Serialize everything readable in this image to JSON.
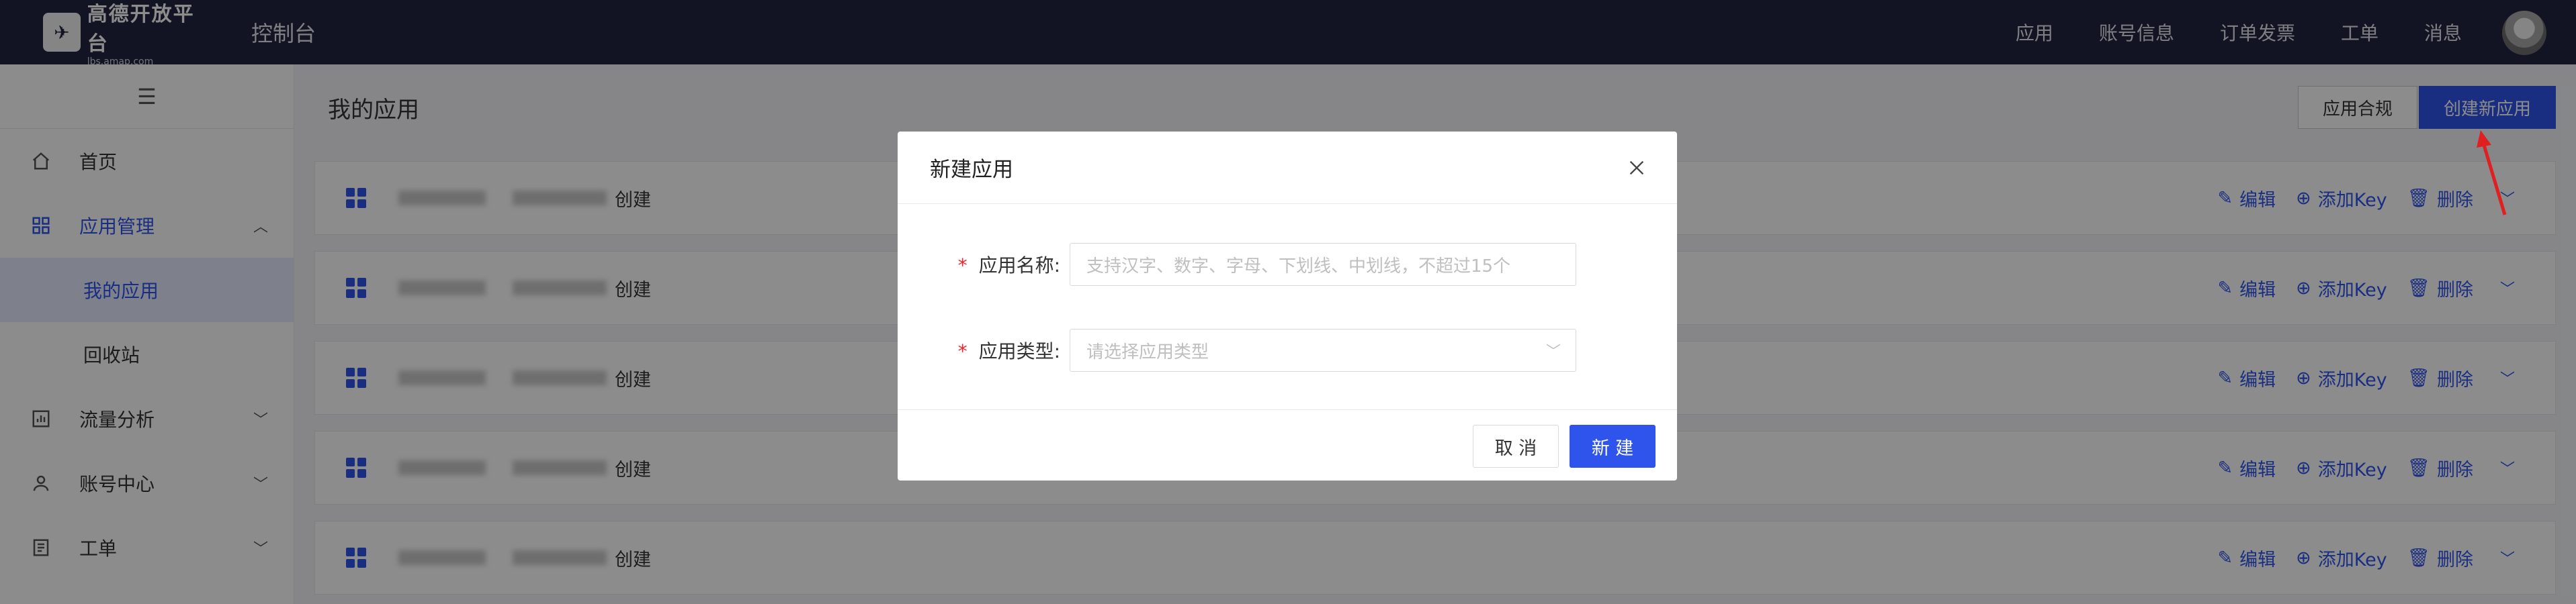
{
  "topbar": {
    "logo_main": "高德开放平台",
    "logo_sub": "lbs.amap.com",
    "console_title": "控制台",
    "nav": [
      "应用",
      "账号信息",
      "订单发票",
      "工单",
      "消息"
    ]
  },
  "sidebar": {
    "toggle_icon": "menu-icon",
    "home": "首页",
    "app_mgmt": "应用管理",
    "my_apps": "我的应用",
    "recycle": "回收站",
    "traffic": "流量分析",
    "account": "账号中心",
    "ticket": "工单"
  },
  "main": {
    "title": "我的应用",
    "comply_btn": "应用合规",
    "create_btn": "创建新应用",
    "rows": [
      {
        "created": "创建"
      },
      {
        "created": "创建"
      },
      {
        "created": "创建"
      },
      {
        "created": "创建"
      },
      {
        "created": "创建"
      }
    ],
    "actions": {
      "edit": "编辑",
      "add_key": "添加Key",
      "delete": "删除"
    }
  },
  "modal": {
    "title": "新建应用",
    "name_label": "应用名称:",
    "name_placeholder": "支持汉字、数字、字母、下划线、中划线，不超过15个",
    "type_label": "应用类型:",
    "type_placeholder": "请选择应用类型",
    "required_mark": "*",
    "cancel": "取 消",
    "ok": "新 建"
  },
  "colors": {
    "brand": "#2f54eb",
    "topbar": "#222640",
    "annotation_arrow": "#e02020"
  }
}
